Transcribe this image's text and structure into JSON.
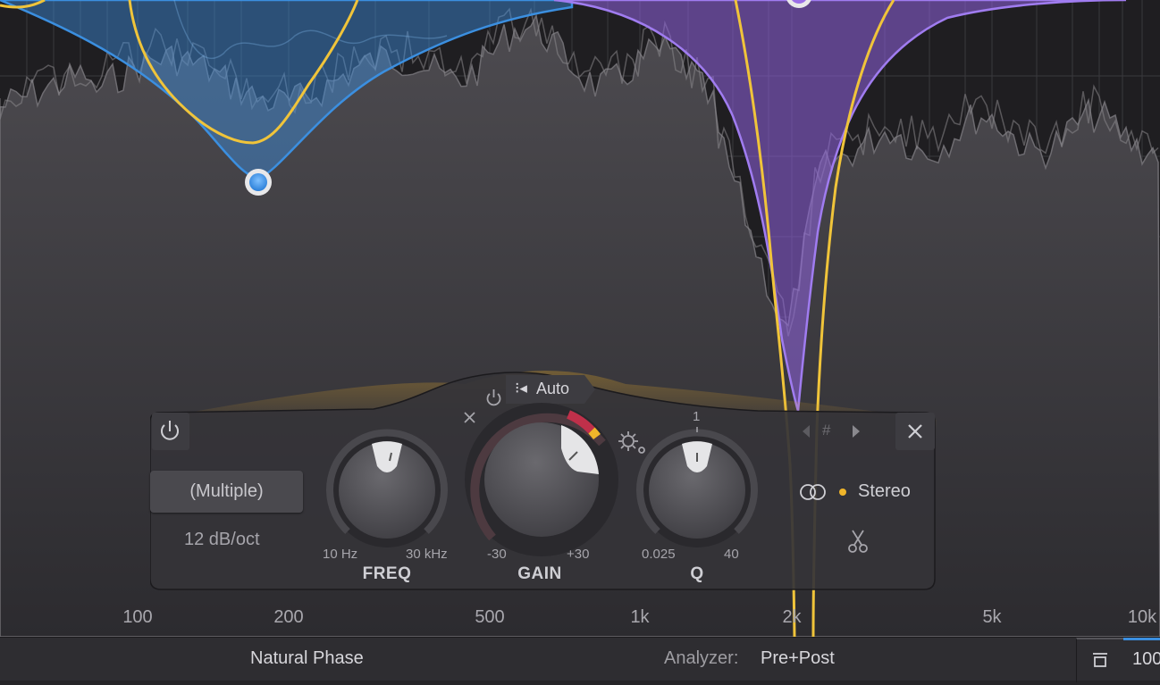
{
  "frequency_axis": {
    "labels": [
      "100",
      "200",
      "500",
      "1k",
      "2k",
      "5k",
      "10k"
    ]
  },
  "band_panel": {
    "shape_value": "(Multiple)",
    "slope_value": "12 dB/oct",
    "auto_label": "Auto",
    "freq": {
      "label": "FREQ",
      "min_label": "10 Hz",
      "max_label": "30 kHz"
    },
    "gain": {
      "label": "GAIN",
      "min_label": "-30",
      "max_label": "+30"
    },
    "q": {
      "label": "Q",
      "min_label": "0.025",
      "max_label": "40",
      "center_label": "1"
    },
    "band_nav_symbol": "#",
    "stereo_label": "Stereo"
  },
  "status_bar": {
    "processing_mode": "Natural Phase",
    "analyzer_label": "Analyzer:",
    "analyzer_value": "Pre+Post",
    "zoom_value": "100"
  },
  "colors": {
    "background": "#262528",
    "band_blue": "#3b8fe0",
    "band_purple": "#9a6ee6",
    "eq_curve_yellow": "#f0c43a",
    "analyzer_fill": "#4a484c"
  },
  "icons": [
    "power-icon",
    "close-icon",
    "auto-icon",
    "gear-icon",
    "stereo-icon",
    "scissors-icon",
    "prev-band-icon",
    "next-band-icon",
    "collapse-icon"
  ]
}
